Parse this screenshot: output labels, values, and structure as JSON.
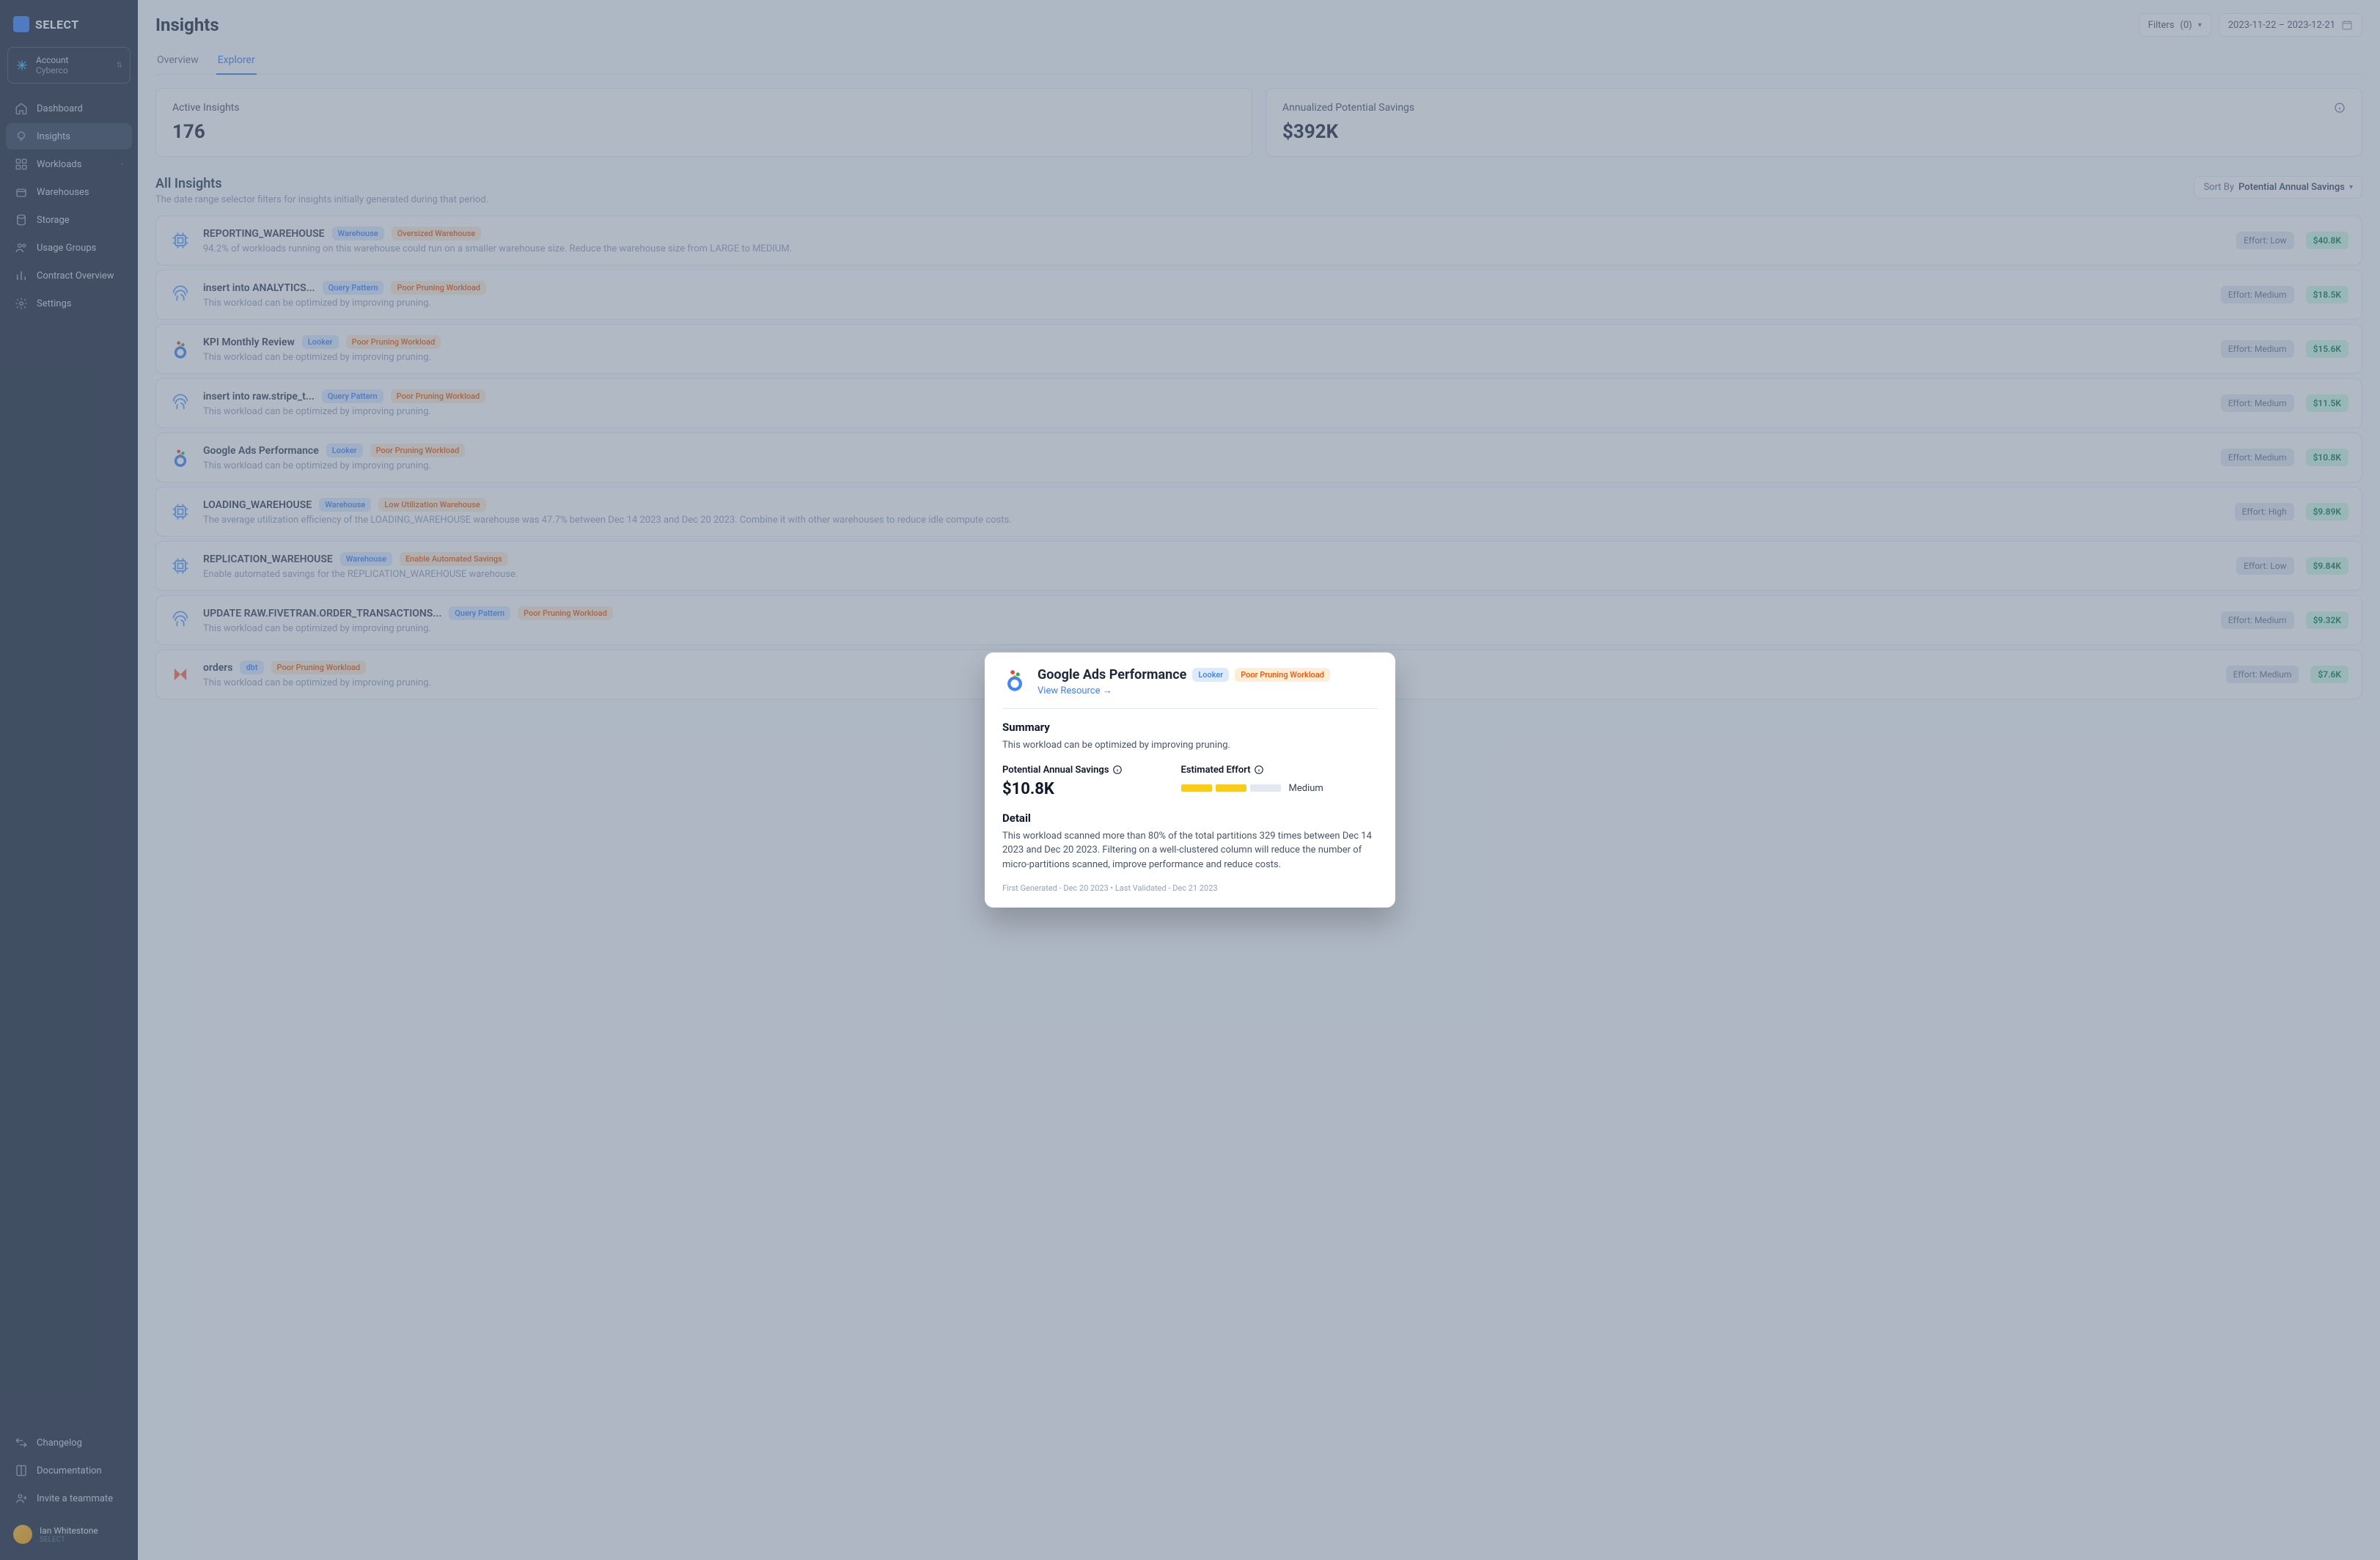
{
  "brand": "SELECT",
  "account": {
    "label": "Account",
    "name": "Cyberco"
  },
  "nav": {
    "dashboard": "Dashboard",
    "insights": "Insights",
    "workloads": "Workloads",
    "warehouses": "Warehouses",
    "storage": "Storage",
    "usage_groups": "Usage Groups",
    "contract": "Contract Overview",
    "settings": "Settings"
  },
  "bottom": {
    "changelog": "Changelog",
    "docs": "Documentation",
    "invite": "Invite a teammate"
  },
  "user": {
    "name": "Ian Whitestone",
    "org": "SELECT"
  },
  "page": {
    "title": "Insights"
  },
  "head": {
    "filters_label": "Filters",
    "filters_count": "(0)",
    "date_range": "2023-11-22 – 2023-12-21"
  },
  "tabs": {
    "overview": "Overview",
    "explorer": "Explorer"
  },
  "kpi": {
    "active_label": "Active Insights",
    "active_value": "176",
    "savings_label": "Annualized Potential Savings",
    "savings_value": "$392K"
  },
  "section": {
    "title": "All Insights",
    "sub": "The date range selector filters for insights initially generated during that period.",
    "sort_label": "Sort By",
    "sort_value": "Potential Annual Savings"
  },
  "icons": {
    "cpu": "cpu",
    "finger": "finger",
    "looker": "looker",
    "dbt": "dbt"
  },
  "rows": [
    {
      "icon": "cpu",
      "title": "REPORTING_WAREHOUSE",
      "tag1": "Warehouse",
      "tag2": "Oversized Warehouse",
      "desc": "94.2% of workloads running on this warehouse could run on a smaller warehouse size. Reduce the warehouse size from LARGE to MEDIUM.",
      "effort": "Effort: Low",
      "savings": "$40.8K"
    },
    {
      "icon": "finger",
      "title": "insert into ANALYTICS...",
      "tag1": "Query Pattern",
      "tag2": "Poor Pruning Workload",
      "desc": "This workload can be optimized by improving pruning.",
      "effort": "Effort: Medium",
      "savings": "$18.5K"
    },
    {
      "icon": "looker",
      "title": "KPI Monthly Review",
      "tag1": "Looker",
      "tag2": "Poor Pruning Workload",
      "desc": "This workload can be optimized by improving pruning.",
      "effort": "Effort: Medium",
      "savings": "$15.6K"
    },
    {
      "icon": "finger",
      "title": "insert into raw.stripe_t...",
      "tag1": "Query Pattern",
      "tag2": "Poor Pruning Workload",
      "desc": "This workload can be optimized by improving pruning.",
      "effort": "Effort: Medium",
      "savings": "$11.5K"
    },
    {
      "icon": "looker",
      "title": "Google Ads Performance",
      "tag1": "Looker",
      "tag2": "Poor Pruning Workload",
      "desc": "This workload can be optimized by improving pruning.",
      "effort": "Effort: Medium",
      "savings": "$10.8K"
    },
    {
      "icon": "cpu",
      "title": "LOADING_WAREHOUSE",
      "tag1": "Warehouse",
      "tag2": "Low Utilization Warehouse",
      "desc": "The average utilization efficiency of the LOADING_WAREHOUSE warehouse was 47.7% between Dec 14 2023 and Dec 20 2023. Combine it with other warehouses to reduce idle compute costs.",
      "effort": "Effort: High",
      "savings": "$9.89K"
    },
    {
      "icon": "cpu",
      "title": "REPLICATION_WAREHOUSE",
      "tag1": "Warehouse",
      "tag2": "Enable Automated Savings",
      "desc": "Enable automated savings for the REPLICATION_WAREHOUSE warehouse.",
      "effort": "Effort: Low",
      "savings": "$9.84K"
    },
    {
      "icon": "finger",
      "title": "UPDATE RAW.FIVETRAN.ORDER_TRANSACTIONS...",
      "tag1": "Query Pattern",
      "tag2": "Poor Pruning Workload",
      "desc": "This workload can be optimized by improving pruning.",
      "effort": "Effort: Medium",
      "savings": "$9.32K"
    },
    {
      "icon": "dbt",
      "title": "orders",
      "tag1": "dbt",
      "tag2": "Poor Pruning Workload",
      "desc": "This workload can be optimized by improving pruning.",
      "effort": "Effort: Medium",
      "savings": "$7.6K"
    }
  ],
  "modal": {
    "title": "Google Ads Performance",
    "tag1": "Looker",
    "tag2": "Poor Pruning Workload",
    "view": "View Resource →",
    "summary_h": "Summary",
    "summary": "This workload can be optimized by improving pruning.",
    "pas_label": "Potential Annual Savings",
    "pas_value": "$10.8K",
    "effort_label": "Estimated Effort",
    "effort_level": "Medium",
    "detail_h": "Detail",
    "detail": "This workload scanned more than 80% of the total partitions 329 times between Dec 14 2023 and Dec 20 2023. Filtering on a well-clustered column will reduce the number of micro-partitions scanned, improve performance and reduce costs.",
    "footer": "First Generated - Dec 20 2023   •   Last Validated - Dec 21 2023"
  }
}
